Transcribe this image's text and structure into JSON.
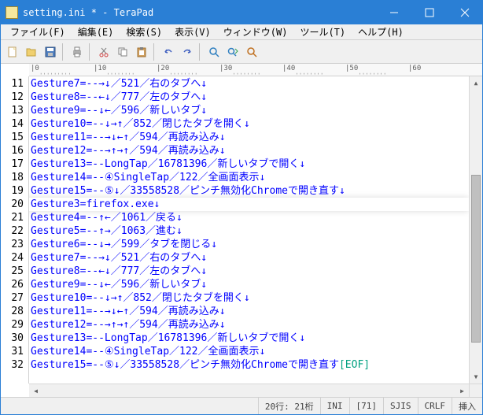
{
  "title": "setting.ini * - TeraPad",
  "menu": {
    "file": "ファイル(F)",
    "edit": "編集(E)",
    "search": "検索(S)",
    "view": "表示(V)",
    "window": "ウィンドウ(W)",
    "tool": "ツール(T)",
    "help": "ヘルプ(H)"
  },
  "ruler_ticks": [
    "|0",
    "|10",
    "|20",
    "|30",
    "|40",
    "|50",
    "|60"
  ],
  "lines": [
    {
      "n": 11,
      "t": "Gesture7=--→↓／521／右のタブへ↓"
    },
    {
      "n": 12,
      "t": "Gesture8=--←↓／777／左のタブへ↓"
    },
    {
      "n": 13,
      "t": "Gesture9=--↓←／596／新しいタブ↓"
    },
    {
      "n": 14,
      "t": "Gesture10=--↓→↑／852／閉じたタブを開く↓"
    },
    {
      "n": 15,
      "t": "Gesture11=--→↓←↑／594／再読み込み↓"
    },
    {
      "n": 16,
      "t": "Gesture12=--→↑→↑／594／再読み込み↓"
    },
    {
      "n": 17,
      "t": "Gesture13=--LongTap／16781396／新しいタブで開く↓"
    },
    {
      "n": 18,
      "t": "Gesture14=--④SingleTap／122／全画面表示↓"
    },
    {
      "n": 19,
      "t": "Gesture15=--⑤↓／33558528／ピンチ無効化Chromeで開き直す↓"
    },
    {
      "n": 20,
      "t": "Gesture3=firefox.exe↓",
      "hl": true
    },
    {
      "n": 21,
      "t": "Gesture4=--↑←／1061／戻る↓"
    },
    {
      "n": 22,
      "t": "Gesture5=--↑→／1063／進む↓"
    },
    {
      "n": 23,
      "t": "Gesture6=--↓→／599／タブを閉じる↓"
    },
    {
      "n": 24,
      "t": "Gesture7=--→↓／521／右のタブへ↓"
    },
    {
      "n": 25,
      "t": "Gesture8=--←↓／777／左のタブへ↓"
    },
    {
      "n": 26,
      "t": "Gesture9=--↓←／596／新しいタブ↓"
    },
    {
      "n": 27,
      "t": "Gesture10=--↓→↑／852／閉じたタブを開く↓"
    },
    {
      "n": 28,
      "t": "Gesture11=--→↓←↑／594／再読み込み↓"
    },
    {
      "n": 29,
      "t": "Gesture12=--→↑→↑／594／再読み込み↓"
    },
    {
      "n": 30,
      "t": "Gesture13=--LongTap／16781396／新しいタブで開く↓"
    },
    {
      "n": 31,
      "t": "Gesture14=--④SingleTap／122／全画面表示↓"
    },
    {
      "n": 32,
      "t": "Gesture15=--⑤↓／33558528／ピンチ無効化Chromeで開き直す[EOF]",
      "eof": true
    }
  ],
  "status": {
    "pos": "20行: 21桁",
    "mode": "INI",
    "code": "[71]",
    "enc": "SJIS",
    "eol": "CRLF",
    "ins": "挿入"
  }
}
